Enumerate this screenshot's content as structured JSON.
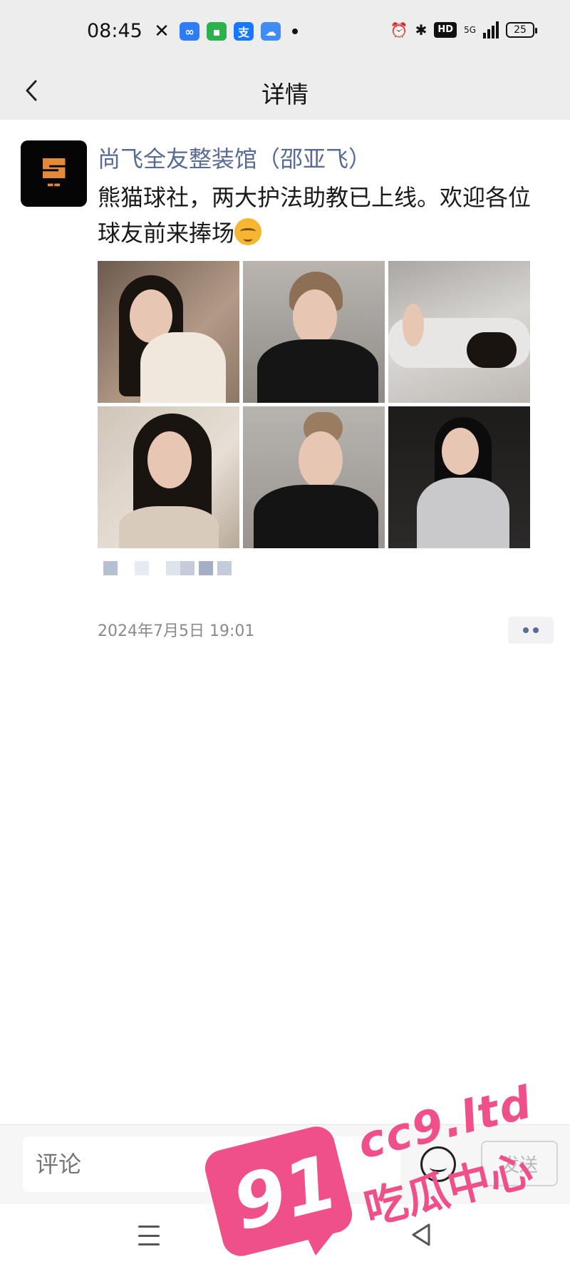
{
  "status_bar": {
    "time": "08:45",
    "battery": "25",
    "network": "5G",
    "hd_badge": "HD",
    "app_icons": [
      "x-icon",
      "infinity-app-icon",
      "chat-app-icon",
      "alipay-icon",
      "weather-icon"
    ]
  },
  "nav": {
    "title": "详情"
  },
  "post": {
    "author": "尚飞全友整装馆（邵亚飞）",
    "text": "熊猫球社，两大护法助教已上线。欢迎各位球友前来捧场",
    "emoji": "relieved-face-emoji",
    "time": "2024年7月5日 19:01",
    "photos": [
      "photo-1",
      "photo-2",
      "photo-3",
      "photo-4",
      "photo-5",
      "photo-6"
    ]
  },
  "comment": {
    "placeholder": "评论",
    "send_label": "发送"
  },
  "watermark": {
    "number": "91",
    "domain": "cc9.ltd",
    "name": "吃瓜中心"
  },
  "colors": {
    "author": "#586b95",
    "header_bg": "#ededed",
    "watermark": "#f0508a"
  }
}
